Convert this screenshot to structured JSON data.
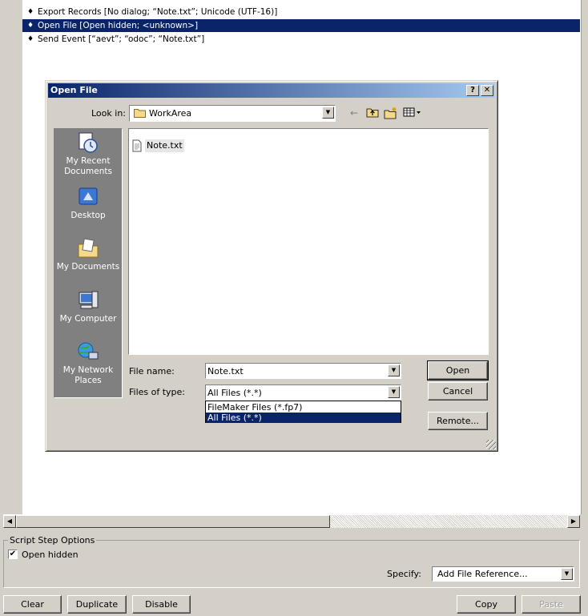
{
  "script_steps": [
    {
      "label": "Export Records [No dialog; “Note.txt”; Unicode (UTF-16)]",
      "selected": false
    },
    {
      "label": "Open File [Open hidden; <unknown>]",
      "selected": true
    },
    {
      "label": "Send Event [“aevt”; “odoc”; “Note.txt”]",
      "selected": false
    }
  ],
  "options": {
    "legend": "Script Step Options",
    "open_hidden_label": "Open hidden",
    "open_hidden_checked": "✔",
    "specify_label": "Specify:",
    "specify_value": "Add File Reference..."
  },
  "bottom_buttons": {
    "clear": "Clear",
    "duplicate": "Duplicate",
    "disable": "Disable",
    "copy": "Copy",
    "paste": "Paste"
  },
  "dialog": {
    "title": "Open File",
    "help": "?",
    "close": "✕",
    "look_in_label": "Look in:",
    "look_in_value": "WorkArea",
    "places": {
      "recent": "My Recent Documents",
      "desktop": "Desktop",
      "documents": "My Documents",
      "computer": "My Computer",
      "network": "My Network Places"
    },
    "file_item": "Note.txt",
    "file_name_label": "File name:",
    "file_name_value": "Note.txt",
    "files_of_type_label": "Files of type:",
    "files_of_type_value": "All Files (*.*)",
    "type_options": [
      "FileMaker Files (*.fp7)",
      "All Files (*.*)"
    ],
    "open_button": "Open",
    "cancel_button": "Cancel",
    "remote_button": "Remote..."
  },
  "colors": {
    "selection": "#0a246a",
    "window_bg": "#d4d0c8"
  }
}
